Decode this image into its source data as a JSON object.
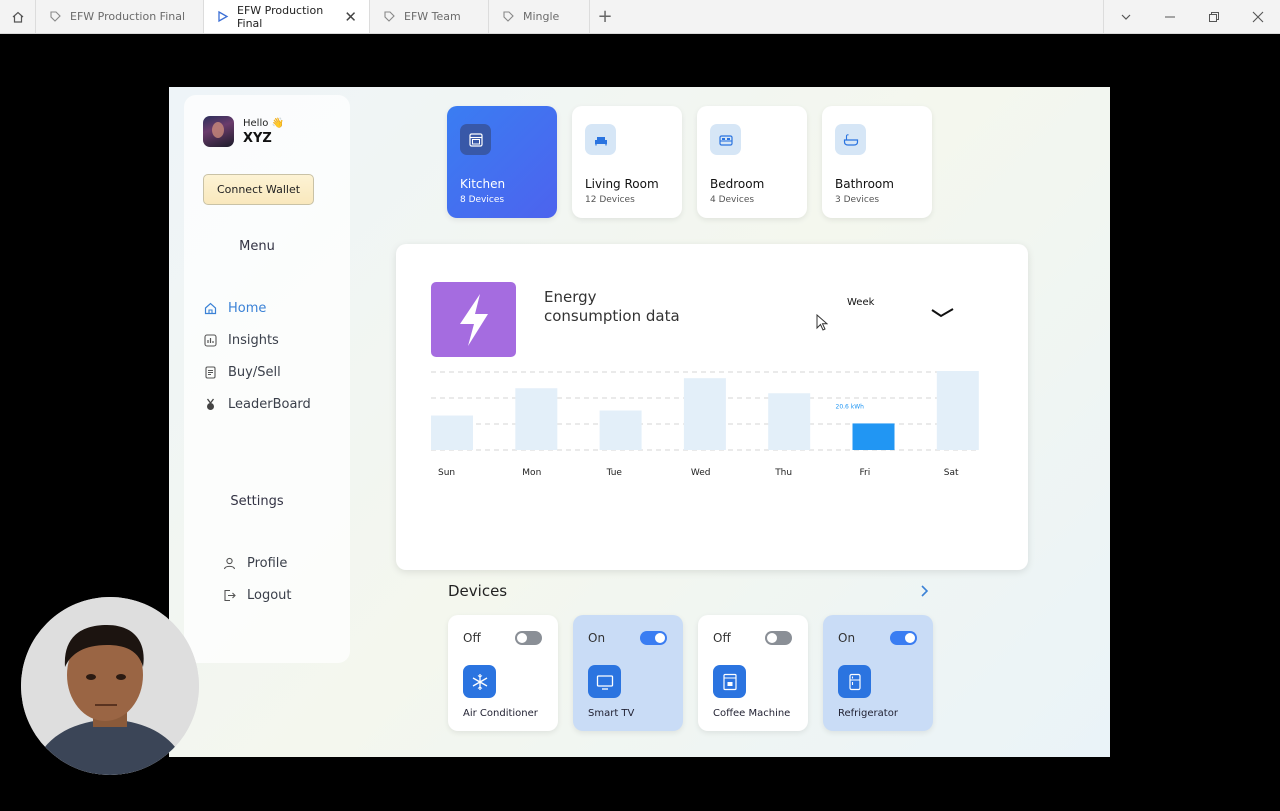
{
  "browser": {
    "tabs": [
      {
        "label": "EFW Production Final",
        "active": false,
        "icon": "figma-tag-icon"
      },
      {
        "label": "EFW Production Final",
        "active": true,
        "icon": "play-icon"
      },
      {
        "label": "EFW Team",
        "active": false,
        "icon": "figma-tag-icon"
      },
      {
        "label": "Mingle",
        "active": false,
        "icon": "figma-tag-icon"
      }
    ]
  },
  "sidebar": {
    "greeting": "Hello 👋",
    "username": "XYZ",
    "connect_wallet": "Connect Wallet",
    "menu_heading": "Menu",
    "menu_items": [
      {
        "label": "Home",
        "icon": "home-icon",
        "active": true
      },
      {
        "label": "Insights",
        "icon": "insights-icon",
        "active": false
      },
      {
        "label": "Buy/Sell",
        "icon": "receipt-icon",
        "active": false
      },
      {
        "label": "LeaderBoard",
        "icon": "medal-icon",
        "active": false
      }
    ],
    "settings_heading": "Settings",
    "settings_items": [
      {
        "label": "Profile",
        "icon": "user-icon"
      },
      {
        "label": "Logout",
        "icon": "logout-icon"
      }
    ]
  },
  "rooms": [
    {
      "name": "Kitchen",
      "count": "8 Devices",
      "active": true,
      "icon": "oven-icon"
    },
    {
      "name": "Living Room",
      "count": "12 Devices",
      "active": false,
      "icon": "sofa-icon"
    },
    {
      "name": "Bedroom",
      "count": "4 Devices",
      "active": false,
      "icon": "bed-icon"
    },
    {
      "name": "Bathroom",
      "count": "3 Devices",
      "active": false,
      "icon": "bathtub-icon"
    }
  ],
  "energy": {
    "title_line1": "Energy",
    "title_line2": "consumption data",
    "period": "Week"
  },
  "chart_data": {
    "type": "bar",
    "categories": [
      "Sun",
      "Mon",
      "Tue",
      "Wed",
      "Thu",
      "Fri",
      "Sat"
    ],
    "values": [
      0.48,
      0.86,
      0.55,
      1.0,
      0.79,
      0.37,
      1.1
    ],
    "highlight_index": 5,
    "highlight_label": "20.6 kWh",
    "colors": {
      "bar": "#e3eff9",
      "highlight": "#2196f3"
    }
  },
  "devices_section": {
    "heading": "Devices",
    "items": [
      {
        "name": "Air Conditioner",
        "state": "Off",
        "on": false,
        "icon": "snowflake-icon"
      },
      {
        "name": "Smart TV",
        "state": "On",
        "on": true,
        "icon": "tv-icon"
      },
      {
        "name": "Coffee Machine",
        "state": "Off",
        "on": false,
        "icon": "coffee-machine-icon"
      },
      {
        "name": "Refrigerator",
        "state": "On",
        "on": true,
        "icon": "fridge-icon"
      }
    ]
  }
}
